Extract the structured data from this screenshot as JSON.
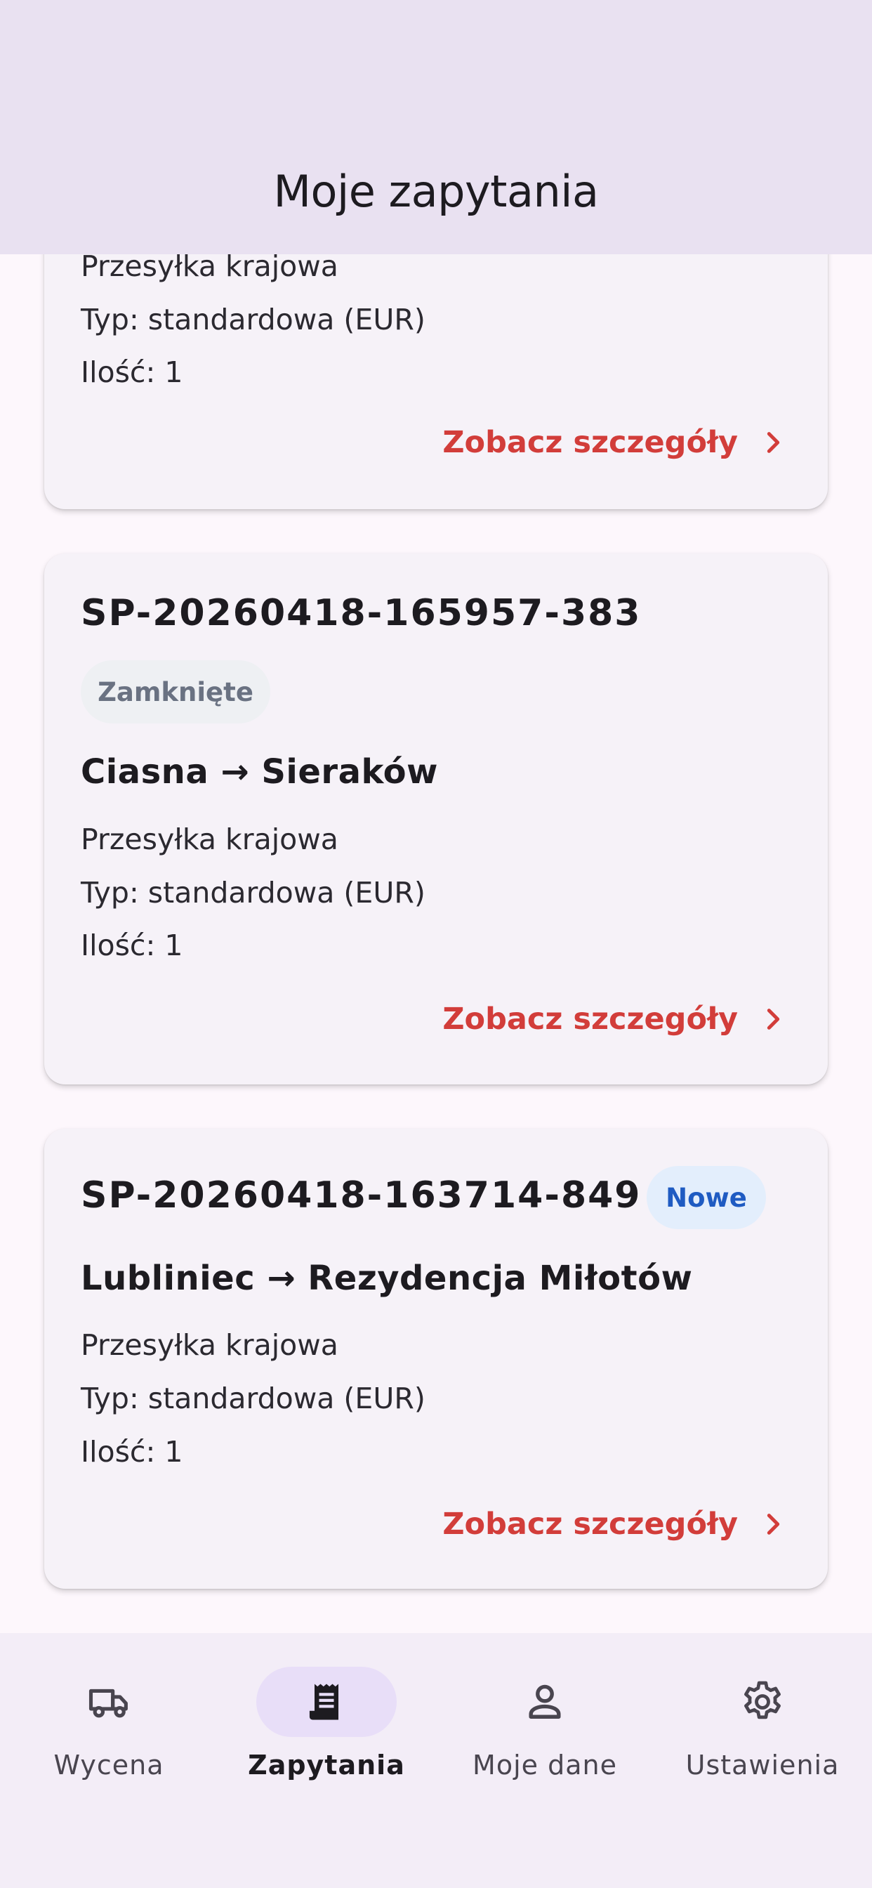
{
  "header": {
    "title": "Moje zapytania"
  },
  "cards": [
    {
      "id": "",
      "badge": "",
      "route": "",
      "shipment": "Przesyłka krajowa",
      "type": "Typ: standardowa (EUR)",
      "quantity": "Ilość: 1",
      "details_label": "Zobacz szczegóły"
    },
    {
      "id": "SP-20260418-165957-383",
      "badge": "Zamknięte",
      "route": "Ciasna → Sieraków",
      "shipment": "Przesyłka krajowa",
      "type": "Typ: standardowa (EUR)",
      "quantity": "Ilość: 1",
      "details_label": "Zobacz szczegóły"
    },
    {
      "id": "SP-20260418-163714-849",
      "badge": "Nowe",
      "route": "Lubliniec → Rezydencja Miłotów",
      "shipment": "Przesyłka krajowa",
      "type": "Typ: standardowa (EUR)",
      "quantity": "Ilość: 1",
      "details_label": "Zobacz szczegóły"
    }
  ],
  "nav": {
    "items": [
      {
        "label": "Wycena",
        "icon": "truck-icon",
        "active": false
      },
      {
        "label": "Zapytania",
        "icon": "receipt-icon",
        "active": true
      },
      {
        "label": "Moje dane",
        "icon": "person-icon",
        "active": false
      },
      {
        "label": "Ustawienia",
        "icon": "gear-icon",
        "active": false
      }
    ]
  },
  "colors": {
    "accent": "#d23d3a",
    "app_bar": "#e9e1f1",
    "nav_active": "#e8def8",
    "badge_new": "#1f5bc2",
    "badge_closed": "#6a7282"
  }
}
